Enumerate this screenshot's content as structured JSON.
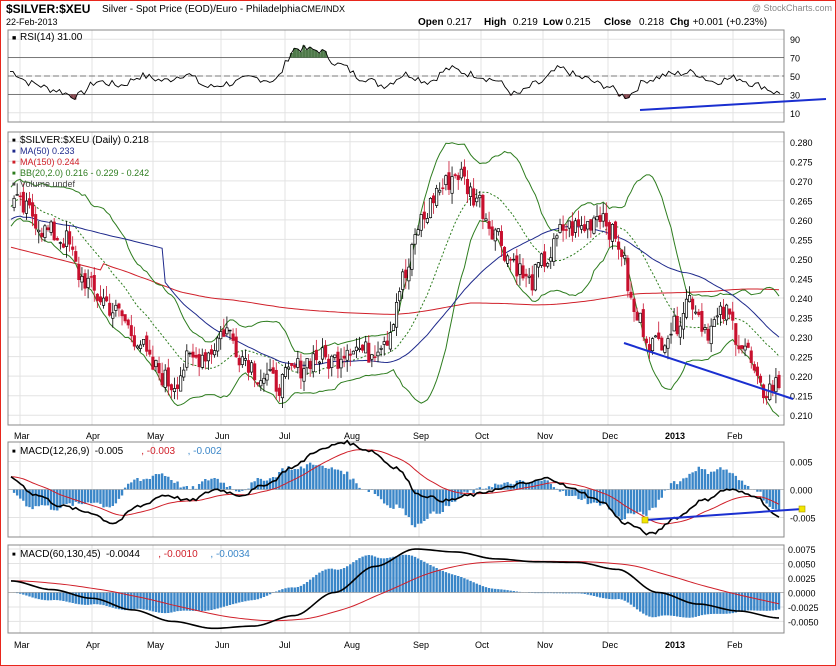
{
  "header": {
    "symbol": "$SILVER:$XEU",
    "description": "Silver - Spot Price (EOD)/Euro - Philadelphia",
    "exchange": "CME/INDX",
    "date": "22-Feb-2013",
    "copyright": "@ StockCharts.com",
    "ohlc": [
      {
        "label": "Open",
        "value": "0.217"
      },
      {
        "label": "High",
        "value": "0.219"
      },
      {
        "label": "Low",
        "value": "0.215"
      },
      {
        "label": "Close",
        "value": "0.218"
      },
      {
        "label": "Chg",
        "value": "+0.001 (+0.23%)"
      }
    ]
  },
  "colors": {
    "frame": "#e8261c",
    "up_candle": "#000000",
    "down_candle": "#c8102e",
    "ma50": "#1f2a8c",
    "ma150": "#d0202a",
    "bollinger": "#2e7d1f",
    "bb_mid": "#2e7d1f",
    "trendline": "#1a2fd0",
    "rsi_overbought": "#4f7a4a",
    "rsi_oversold": "#8a4a52",
    "histogram": "#3a86c8",
    "macd_line": "#000000",
    "signal_line": "#d0202a",
    "annotation_marker": "#f2e600"
  },
  "chart_data": [
    {
      "type": "line",
      "panel": "RSI",
      "label": "RSI(14) 31.00",
      "yticks": [
        "90",
        "70",
        "50",
        "30",
        "10"
      ],
      "ylim": [
        0,
        100
      ],
      "levels": [
        70,
        50,
        30
      ],
      "x": [
        "Mar",
        "Apr",
        "May",
        "Jun",
        "Jul",
        "Aug",
        "Sep",
        "Oct",
        "Nov",
        "Dec",
        "2013",
        "Feb"
      ],
      "keypoints": [
        55,
        42,
        35,
        28,
        44,
        40,
        50,
        45,
        52,
        38,
        42,
        48,
        45,
        80,
        78,
        62,
        48,
        40,
        52,
        44,
        58,
        52,
        46,
        30,
        42,
        58,
        48,
        40,
        28,
        46,
        52,
        54,
        44,
        48,
        40,
        31
      ]
    },
    {
      "type": "candlestick",
      "panel": "Price",
      "legend": [
        "$SILVER:$XEU (Daily) 0.218",
        "MA(50) 0.233",
        "MA(150) 0.244",
        "BB(20,2.0) 0.216 - 0.229 - 0.242",
        "Volume undef"
      ],
      "yticks": [
        "0.280",
        "0.275",
        "0.270",
        "0.265",
        "0.260",
        "0.255",
        "0.250",
        "0.245",
        "0.240",
        "0.235",
        "0.230",
        "0.225",
        "0.220",
        "0.215",
        "0.210"
      ],
      "ylim": [
        0.2075,
        0.2825
      ],
      "x": [
        "Mar",
        "Apr",
        "May",
        "Jun",
        "Jul",
        "Aug",
        "Sep",
        "Oct",
        "Nov",
        "Dec",
        "2013",
        "Feb"
      ],
      "close_keypoints": [
        0.265,
        0.262,
        0.257,
        0.255,
        0.245,
        0.24,
        0.236,
        0.23,
        0.222,
        0.218,
        0.224,
        0.226,
        0.232,
        0.225,
        0.22,
        0.218,
        0.222,
        0.225,
        0.224,
        0.228,
        0.226,
        0.23,
        0.245,
        0.26,
        0.268,
        0.272,
        0.266,
        0.258,
        0.25,
        0.244,
        0.25,
        0.258,
        0.258,
        0.262,
        0.254,
        0.235,
        0.228,
        0.232,
        0.24,
        0.232,
        0.236,
        0.228,
        0.216,
        0.218
      ],
      "ma50_last": 0.233,
      "ma150_last": 0.244,
      "bb_last": [
        0.216,
        0.229,
        0.242
      ]
    },
    {
      "type": "line",
      "panel": "MACD",
      "label": "MACD(12,26,9)",
      "values": [
        "-0.005",
        "-0.003",
        "-0.002"
      ],
      "yticks": [
        "0.005",
        "0.000",
        "-0.005"
      ],
      "ylim": [
        -0.0085,
        0.0085
      ],
      "x": [
        "Mar",
        "Apr",
        "May",
        "Jun",
        "Jul",
        "Aug",
        "Sep",
        "Oct",
        "Nov",
        "Dec",
        "2013",
        "Feb"
      ],
      "keypoints": [
        0.002,
        -0.001,
        -0.003,
        -0.004,
        -0.006,
        -0.003,
        -0.001,
        -0.002,
        0.0,
        -0.001,
        0.001,
        0.004,
        0.007,
        0.0085,
        0.007,
        0.004,
        -0.001,
        -0.002,
        -0.001,
        0.0,
        0.001,
        0.002,
        0.0,
        -0.002,
        -0.006,
        -0.008,
        -0.005,
        -0.002,
        0.0,
        -0.001,
        -0.005
      ]
    },
    {
      "type": "line",
      "panel": "MACD",
      "label": "MACD(60,130,45)",
      "values": [
        "-0.0044",
        "-0.0010",
        "-0.0034"
      ],
      "yticks": [
        "0.0075",
        "0.0050",
        "0.0025",
        "0.0000",
        "-0.0025",
        "-0.0050"
      ],
      "ylim": [
        -0.007,
        0.0082
      ],
      "x": [
        "Mar",
        "Apr",
        "May",
        "Jun",
        "Jul",
        "Aug",
        "Sep",
        "Oct",
        "Nov",
        "Dec",
        "2013",
        "Feb"
      ],
      "keypoints": [
        0.002,
        0.0005,
        -0.001,
        -0.003,
        -0.005,
        -0.0062,
        -0.0058,
        -0.004,
        0.0,
        0.0045,
        0.0075,
        0.007,
        0.0058,
        0.0053,
        0.0052,
        0.004,
        0.0,
        -0.002,
        -0.0032,
        -0.0044
      ]
    }
  ]
}
